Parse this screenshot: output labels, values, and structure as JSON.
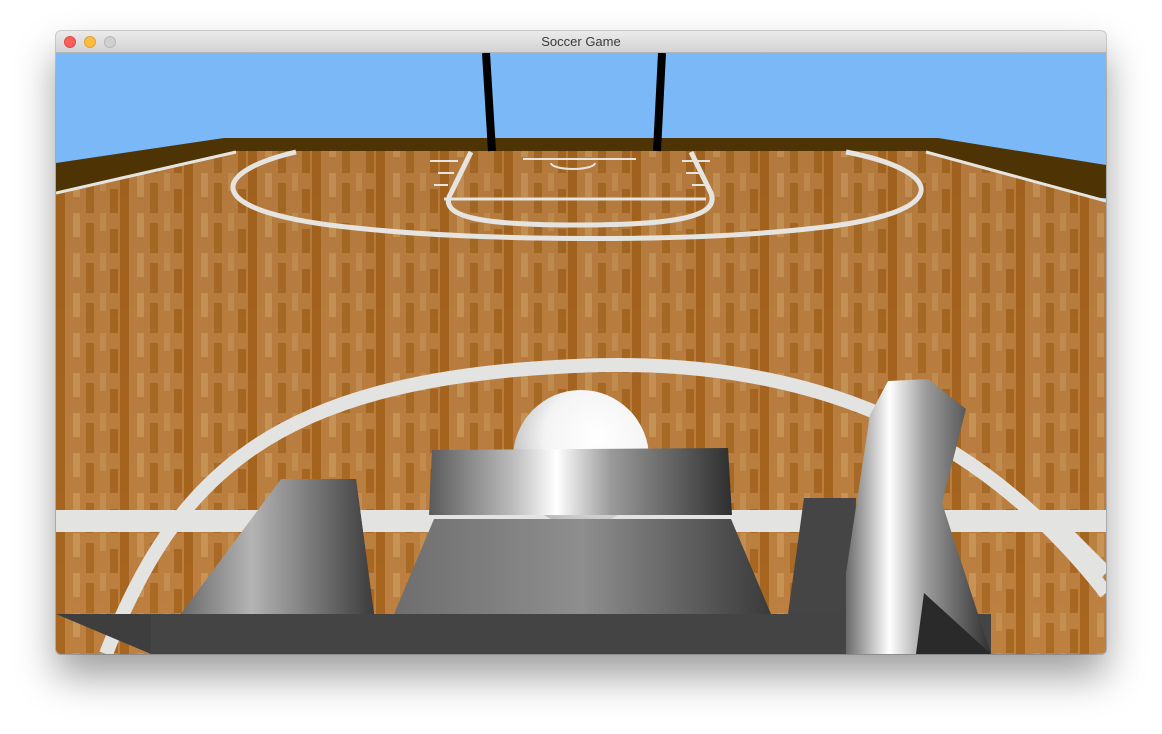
{
  "window": {
    "title": "Soccer Game"
  },
  "scene": {
    "colors": {
      "sky": "#7ab8f8",
      "wall": "#4e3304",
      "floor_light": "#c4894a",
      "floor_dark": "#a8661f",
      "court_line": "#e6e4e0",
      "goal_post": "#000000"
    },
    "objects": [
      "goal-post-left",
      "goal-post-right",
      "ball",
      "player-body",
      "player-arm"
    ]
  }
}
